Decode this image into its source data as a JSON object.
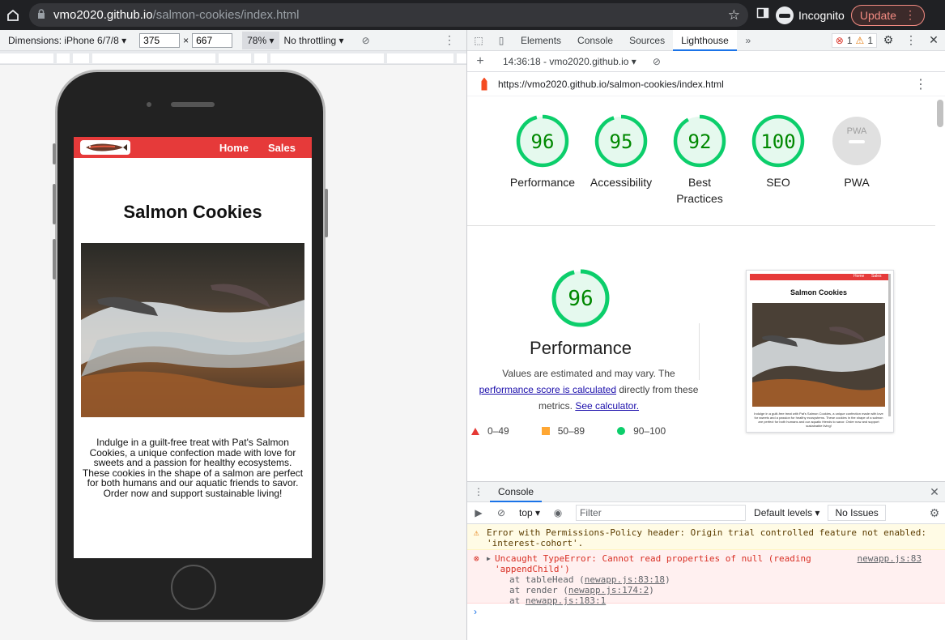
{
  "browser": {
    "host": "vmo2020.github.io",
    "path": "/salmon-cookies/index.html",
    "incognito_label": "Incognito",
    "update_label": "Update"
  },
  "device_toolbar": {
    "device": "Dimensions: iPhone 6/7/8 ▾",
    "width": "375",
    "height": "667",
    "zoom": "78% ▾",
    "throttle": "No throttling ▾"
  },
  "site": {
    "nav": [
      "Home",
      "Sales"
    ],
    "title": "Salmon Cookies",
    "description": "Indulge in a guilt-free treat with Pat's Salmon Cookies, a unique confection made with love for sweets and a passion for healthy ecosystems. These cookies in the shape of a salmon are perfect for both humans and our aquatic friends to savor. Order now and support sustainable living!"
  },
  "devtools": {
    "tabs": [
      "Elements",
      "Console",
      "Sources",
      "Lighthouse"
    ],
    "active_tab": "Lighthouse",
    "error_count": "1",
    "warning_count": "1",
    "run_label": "14:36:18 - vmo2020.github.io ▾",
    "report_url": "https://vmo2020.github.io/salmon-cookies/index.html"
  },
  "lighthouse": {
    "scores": [
      {
        "label": "Performance",
        "value": 96
      },
      {
        "label": "Accessibility",
        "value": 95
      },
      {
        "label": "Best Practices",
        "value": 92
      },
      {
        "label": "SEO",
        "value": 100
      },
      {
        "label": "PWA",
        "value": null,
        "badge": "PWA"
      }
    ],
    "perf_score": "96",
    "perf_title": "Performance",
    "desc_1": "Values are estimated and may vary. The",
    "desc_link": "performance score is calculated",
    "desc_2": "directly from these metrics.",
    "desc_link2": "See calculator.",
    "legend": [
      "0–49",
      "50–89",
      "90–100"
    ],
    "colors": {
      "pass": "#0cce6b",
      "average": "#ffa733",
      "fail": "#e53935",
      "pass_bg": "#e5f9ee"
    }
  },
  "console": {
    "tab": "Console",
    "context": "top ▾",
    "filter_placeholder": "Filter",
    "levels": "Default levels ▾",
    "issues": "No Issues",
    "warning": "Error with Permissions-Policy header: Origin trial controlled feature not enabled: 'interest-cohort'.",
    "error": "Uncaught TypeError: Cannot read properties of null (reading 'appendChild')",
    "error_source": "newapp.js:83",
    "stack": [
      {
        "fn": "at tableHead (",
        "loc": "newapp.js:83:18",
        "end": ")"
      },
      {
        "fn": "at render (",
        "loc": "newapp.js:174:2",
        "end": ")"
      },
      {
        "fn": "at ",
        "loc": "newapp.js:183:1",
        "end": ""
      }
    ]
  }
}
